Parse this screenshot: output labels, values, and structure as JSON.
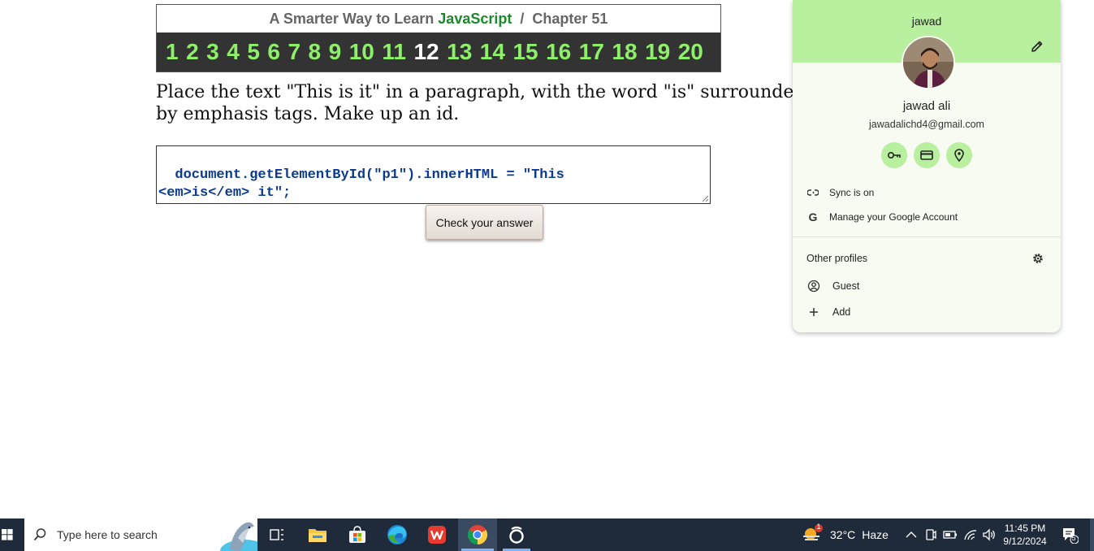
{
  "page": {
    "header": {
      "title_prefix": "A Smarter Way to Learn",
      "brand": "JavaScript",
      "separator": "/",
      "chapter": "Chapter 51",
      "chapters": [
        "1",
        "2",
        "3",
        "4",
        "5",
        "6",
        "7",
        "8",
        "9",
        "10",
        "11",
        "12",
        "13",
        "14",
        "15",
        "16",
        "17",
        "18",
        "19",
        "20"
      ],
      "current_chapter": "12"
    },
    "prompt": "Place the text \"This is it\" in a paragraph, with the word \"is\" surrounded by emphasis tags. Make up an id.",
    "answer_code": "document.getElementById(\"p1\").innerHTML = \"This\n<em>is</em> it\";",
    "check_button": "Check your answer"
  },
  "profile_panel": {
    "profile_name": "jawad",
    "full_name": "jawad ali",
    "email": "jawadalichd4@gmail.com",
    "quick_actions": [
      "key-icon",
      "card-icon",
      "location-pin-icon"
    ],
    "sync_label": "Sync is on",
    "manage_label": "Manage your Google Account",
    "other_profiles_title": "Other profiles",
    "guest_label": "Guest",
    "add_label": "Add",
    "accent_color": "#b8f0a0"
  },
  "taskbar": {
    "search_placeholder": "Type here to search",
    "weather_temp": "32°C",
    "weather_cond": "Haze",
    "weather_badge": "1",
    "time": "11:45 PM",
    "date": "9/12/2024",
    "notification_count": "5"
  }
}
